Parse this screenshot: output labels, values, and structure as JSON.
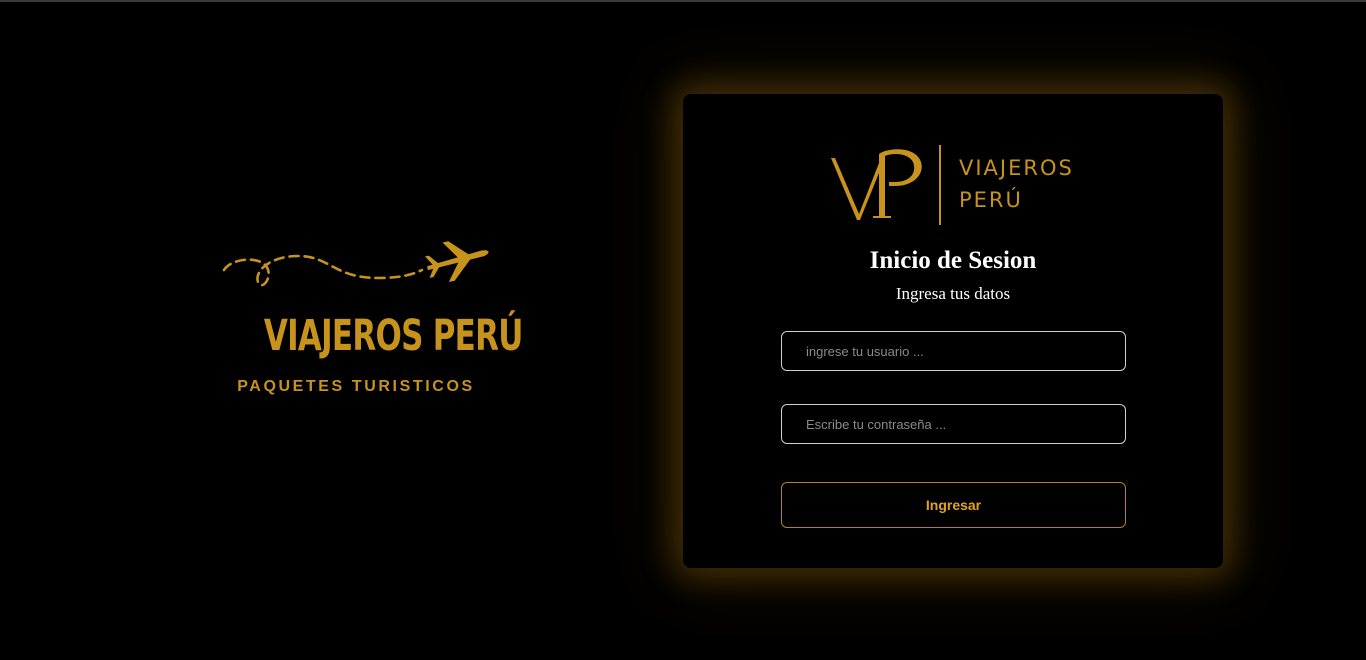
{
  "colors": {
    "background": "#000000",
    "brand_gold": "#c8931c",
    "button_text": "#e0a326",
    "input_border": "#cfcfcf",
    "text_white": "#ffffff"
  },
  "brand_logo": {
    "icon": "airplane-icon",
    "title": "VIAJEROS PERÚ",
    "subtitle": "PAQUETES TURISTICOS"
  },
  "login_card": {
    "logo": {
      "monogram": "VP",
      "word_line_1": "VIAJEROS",
      "word_line_2": "PERÚ"
    },
    "title": "Inicio de Sesion",
    "subtitle": "Ingresa tus datos",
    "username": {
      "value": "",
      "placeholder": "ingrese tu usuario ..."
    },
    "password": {
      "value": "",
      "placeholder": "Escribe tu contraseña ..."
    },
    "submit_label": "Ingresar"
  }
}
